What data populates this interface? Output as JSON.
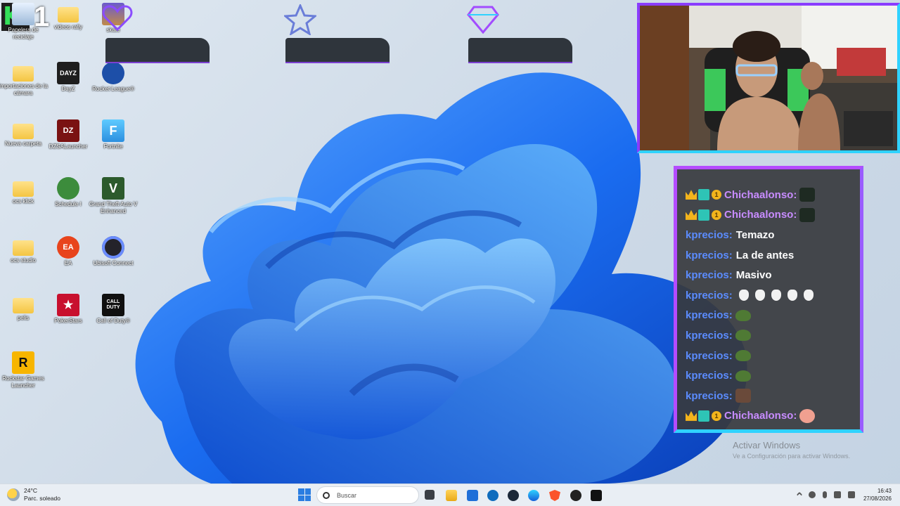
{
  "desktop": {
    "badge": {
      "number": "1"
    },
    "icons": [
      {
        "label": "Papelera de reciclaje",
        "icon": "recycle-bin-icon"
      },
      {
        "label": "videos rally",
        "icon": "folder-icon"
      },
      {
        "label": "skate",
        "icon": "skate-game-icon"
      },
      {
        "label": "Importaciones de la cámara",
        "icon": "folder-icon"
      },
      {
        "label": "DayZ",
        "icon": "dayz-icon",
        "text": "DAYZ"
      },
      {
        "label": "Rocket League®",
        "icon": "rocket-league-icon"
      },
      {
        "label": "Nueva carpeta",
        "icon": "folder-icon"
      },
      {
        "label": "DZSALauncher",
        "icon": "dzsa-launcher-icon",
        "text": "DZ"
      },
      {
        "label": "Fortnite",
        "icon": "fortnite-icon",
        "text": "F"
      },
      {
        "label": "ocs klick",
        "icon": "folder-icon"
      },
      {
        "label": "Schedule I",
        "icon": "schedule-one-icon"
      },
      {
        "label": "Grand Theft Auto V Enhanced",
        "icon": "gta-v-icon",
        "text": "V"
      },
      {
        "label": "ocs studio",
        "icon": "folder-icon"
      },
      {
        "label": "EA",
        "icon": "ea-icon",
        "text": "EA"
      },
      {
        "label": "Ubisoft Connect",
        "icon": "ubisoft-connect-icon"
      },
      {
        "label": "pelis",
        "icon": "folder-icon"
      },
      {
        "label": "PokerStars",
        "icon": "pokerstars-icon",
        "text": "★"
      },
      {
        "label": "Call of Duty®",
        "icon": "call-of-duty-icon",
        "text": "CALL DUTY"
      },
      {
        "label": "Rockstar Games Launcher",
        "icon": "rockstar-launcher-icon",
        "text": "R"
      }
    ],
    "overlay_icons": [
      "heart-icon",
      "star-icon",
      "diamond-icon"
    ]
  },
  "chat": {
    "messages": [
      {
        "user": "Chichaalonso:",
        "style": "purple",
        "badges": true,
        "badge_num": "1",
        "text": "",
        "emotes": [
          "dark"
        ]
      },
      {
        "user": "Chichaalonso:",
        "style": "purple",
        "badges": true,
        "badge_num": "1",
        "text": "",
        "emotes": [
          "dark"
        ]
      },
      {
        "user": "kprecios:",
        "style": "blue",
        "badges": false,
        "text": "Temazo",
        "emotes": []
      },
      {
        "user": "kprecios:",
        "style": "blue",
        "badges": false,
        "text": "La de antes",
        "emotes": []
      },
      {
        "user": "kprecios:",
        "style": "blue",
        "badges": false,
        "text": "Masivo",
        "emotes": []
      },
      {
        "user": "kprecios:",
        "style": "blue",
        "badges": false,
        "text": "",
        "emotes": [
          "hand",
          "hand",
          "hand",
          "hand",
          "hand"
        ]
      },
      {
        "user": "kprecios:",
        "style": "blue",
        "badges": false,
        "text": "",
        "emotes": [
          "green"
        ]
      },
      {
        "user": "kprecios:",
        "style": "blue",
        "badges": false,
        "text": "",
        "emotes": [
          "green"
        ]
      },
      {
        "user": "kprecios:",
        "style": "blue",
        "badges": false,
        "text": "",
        "emotes": [
          "green"
        ]
      },
      {
        "user": "kprecios:",
        "style": "blue",
        "badges": false,
        "text": "",
        "emotes": [
          "green"
        ]
      },
      {
        "user": "kprecios:",
        "style": "blue",
        "badges": false,
        "text": "",
        "emotes": [
          "face"
        ]
      },
      {
        "user": "Chichaalonso:",
        "style": "purple",
        "badges": true,
        "badge_num": "1",
        "text": "",
        "emotes": [
          "pink"
        ]
      }
    ]
  },
  "watermark": {
    "title": "Activar Windows",
    "subtitle": "Ve a Configuración para activar Windows."
  },
  "taskbar": {
    "weather_temp": "24°C",
    "weather_desc": "Parc. soleado",
    "search_placeholder": "Buscar",
    "apps": [
      "file-explorer-icon",
      "folder-icon",
      "store-icon",
      "outlook-icon",
      "steam-icon",
      "edge-icon",
      "brave-icon",
      "obs-icon",
      "terminal-icon"
    ],
    "time": "16:43",
    "date": "27/08/2026"
  },
  "colors": {
    "chat_border": "#b44cff",
    "chat_border_accent": "#2fd2ff",
    "user_purple": "#c88cff",
    "user_blue": "#5b8cff"
  }
}
